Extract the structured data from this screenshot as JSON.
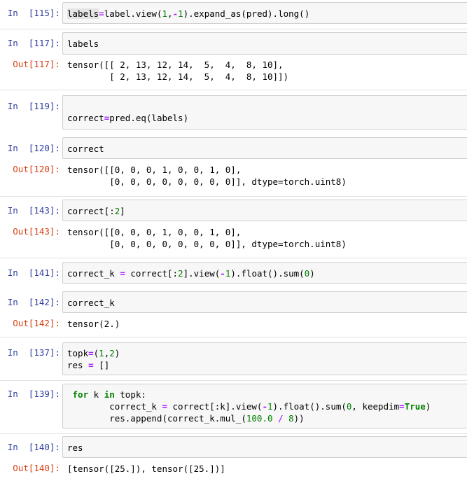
{
  "cells": [
    {
      "in_label": "In  [115]:",
      "code": "labels=label.view(1,-1).expand_as(pred).long()"
    },
    {
      "in_label": "In  [117]:",
      "code": "labels",
      "out_label": "Out[117]:",
      "output": "tensor([[ 2, 13, 12, 14,  5,  4,  8, 10],\n        [ 2, 13, 12, 14,  5,  4,  8, 10]])"
    },
    {
      "in_label": "In  [119]:",
      "code": "correct=pred.eq(labels)"
    },
    {
      "in_label": "In  [120]:",
      "code": "correct",
      "out_label": "Out[120]:",
      "output": "tensor([[0, 0, 0, 1, 0, 0, 1, 0],\n        [0, 0, 0, 0, 0, 0, 0, 0]], dtype=torch.uint8)"
    },
    {
      "in_label": "In  [143]:",
      "code": "correct[:2]",
      "out_label": "Out[143]:",
      "output": "tensor([[0, 0, 0, 1, 0, 0, 1, 0],\n        [0, 0, 0, 0, 0, 0, 0, 0]], dtype=torch.uint8)"
    },
    {
      "in_label": "In  [141]:",
      "code": "correct_k = correct[:2].view(-1).float().sum(0)"
    },
    {
      "in_label": "In  [142]:",
      "code": "correct_k",
      "out_label": "Out[142]:",
      "output": "tensor(2.)"
    },
    {
      "in_label": "In  [137]:",
      "code": "topk=(1,2)\nres = []"
    },
    {
      "in_label": "In  [139]:",
      "code": " for k in topk:\n        correct_k = correct[:k].view(-1).float().sum(0, keepdim=True)\n        res.append(correct_k.mul_(100.0 / 8))"
    },
    {
      "in_label": "In  [140]:",
      "code": "res",
      "out_label": "Out[140]:",
      "output": "[tensor([25.]), tensor([25.])]"
    }
  ],
  "colors": {
    "in_prompt": "#303f9f",
    "out_prompt": "#d84315",
    "input_bg": "#f7f7f7",
    "keyword": "#008000",
    "operator": "#aa22ff"
  }
}
